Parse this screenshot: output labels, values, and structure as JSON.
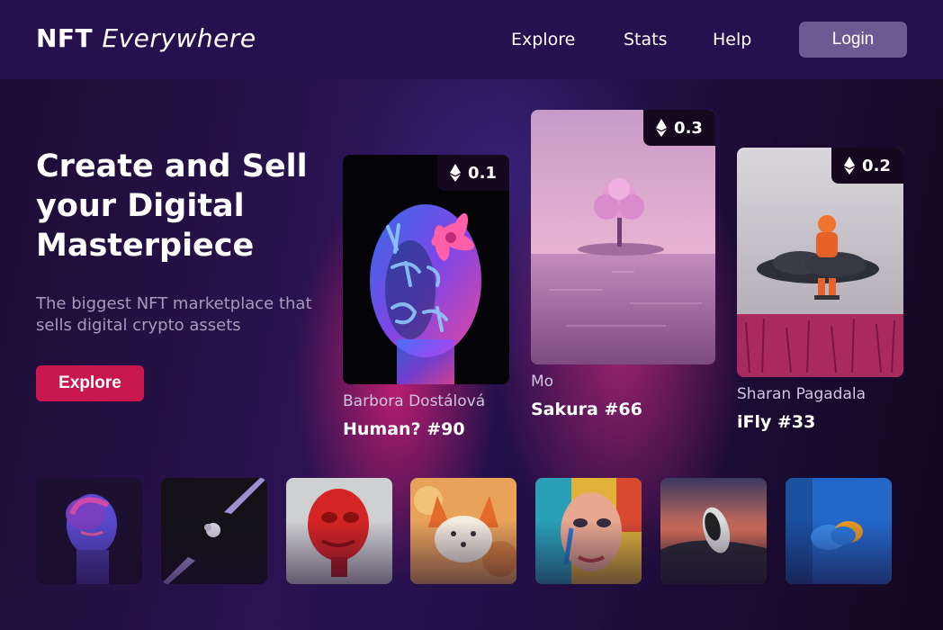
{
  "header": {
    "logo_bold": "NFT",
    "logo_italic": "Everywhere",
    "nav": [
      "Explore",
      "Stats",
      "Help"
    ],
    "login_label": "Login"
  },
  "hero": {
    "title": "Create and Sell your Digital Masterpiece",
    "subtitle": "The biggest NFT marketplace that sells digital crypto assets",
    "cta_label": "Explore"
  },
  "featured": [
    {
      "price": "0.1",
      "artist": "Barbora Dostálová",
      "name": "Human? #90"
    },
    {
      "price": "0.3",
      "artist": "Mo",
      "name": "Sakura #66"
    },
    {
      "price": "0.2",
      "artist": "Sharan Pagadala",
      "name": "iFly #33"
    }
  ],
  "icons": {
    "price": "ethereum-icon"
  },
  "colors": {
    "accent": "#c8174f",
    "header_bg": "#26104d",
    "login_bg": "#6c5a93"
  }
}
